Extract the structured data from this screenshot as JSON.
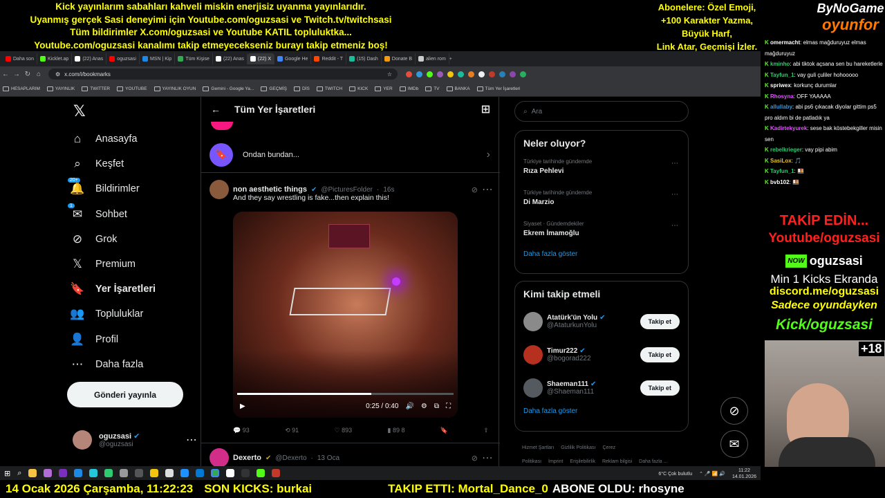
{
  "overlay": {
    "banner_lines": [
      "Kick yayınlarım sabahları kahveli miskin enerjisiz uyanma yayınlarıdır.",
      "Uyanmış gerçek Sasi deneyimi için Youtube.com/oguzsasi ve Twitch.tv/twitchsasi",
      "Tüm bildirimler X.com/oguzsasi ve Youtube KATIL topluluktka...",
      "Youtube.com/oguzsasi kanalımı takip etmeyecekseniz burayı takip etmeniz boş!"
    ],
    "sub_lines": [
      "Abonelere: Özel Emoji,",
      "+100 Karakter Yazma,",
      "Büyük Harf,",
      "Link Atar, Geçmişi İzler."
    ],
    "logo_line1": "ByNoGame",
    "logo_line2": "oyunfor",
    "promo_follow": "TAKİP EDİN...",
    "promo_youtube": "Youtube/oguzsasi",
    "promo_kick_badge": "NOW",
    "promo_kick_name": "oguzsasi",
    "promo_kicks": "Min 1 Kicks Ekranda",
    "promo_discord": "discord.me/oguzsasi",
    "promo_only_game": "Sadece oyundayken",
    "promo_kick_url": "Kick/oguzsasi",
    "age_rating": "+18",
    "ticker_date": "14 Ocak 2026 Çarşamba, 11:22:23",
    "ticker_kicks": "SON KICKS: burkai",
    "ticker_follow": "TAKIP ETTI: Mortal_Dance_0",
    "ticker_sub": "ABONE OLDU: rhosyne"
  },
  "browser": {
    "tabs": [
      {
        "label": "Daha son",
        "color": "#ff0000"
      },
      {
        "label": "Kicklet.ap",
        "color": "#53fc18"
      },
      {
        "label": "(22) Anas",
        "color": "#ffffff"
      },
      {
        "label": "oguzsasi",
        "color": "#ff0000"
      },
      {
        "label": "MSN | Kip",
        "color": "#1e88e5"
      },
      {
        "label": "Tüm Kişise",
        "color": "#34a853"
      },
      {
        "label": "(22) Anas",
        "color": "#ffffff"
      },
      {
        "label": "(22) X",
        "color": "#ffffff"
      },
      {
        "label": "Google He",
        "color": "#4285f4"
      },
      {
        "label": "Reddit - T",
        "color": "#ff4500"
      },
      {
        "label": "(15) Dash",
        "color": "#1abc9c"
      },
      {
        "label": "Donate B",
        "color": "#f39c12"
      },
      {
        "label": "alien rom",
        "color": "#cccccc"
      }
    ],
    "url": "x.com/i/bookmarks",
    "bookmarks": [
      "HESAPLARIM",
      "YAYINLIK",
      "TWITTER",
      "YOUTUBE",
      "YAYINLIK OYUN",
      "Gemini - Google Ya...",
      "GEÇMİŞ",
      "DİS",
      "TWITCH",
      "KICK",
      "YER",
      "IMDb",
      "TV",
      "BANKA",
      "Tüm Yer İşaretleri"
    ]
  },
  "x": {
    "nav": [
      {
        "label": "Anasayfa",
        "icon": "home-icon",
        "glyph": "⌂"
      },
      {
        "label": "Keşfet",
        "icon": "search-icon",
        "glyph": "⌕"
      },
      {
        "label": "Bildirimler",
        "icon": "bell-icon",
        "glyph": "🔔",
        "badge": "20+"
      },
      {
        "label": "Sohbet",
        "icon": "mail-icon",
        "glyph": "✉",
        "badge": "1"
      },
      {
        "label": "Grok",
        "icon": "grok-icon",
        "glyph": "⊘"
      },
      {
        "label": "Premium",
        "icon": "x-premium-icon",
        "glyph": "𝕏"
      },
      {
        "label": "Yer İşaretleri",
        "icon": "bookmark-icon",
        "glyph": "🔖"
      },
      {
        "label": "Topluluklar",
        "icon": "communities-icon",
        "glyph": "👥"
      },
      {
        "label": "Profil",
        "icon": "profile-icon",
        "glyph": "👤"
      },
      {
        "label": "Daha fazla",
        "icon": "more-icon",
        "glyph": "⋯"
      }
    ],
    "post_button": "Gönderi yayınla",
    "me_name": "oguzsasi",
    "me_handle": "@oguzsasi",
    "page_title": "Tüm Yer İşaretleri",
    "folder_name": "Ondan bundan...",
    "tweet": {
      "author": "non aesthetic things",
      "handle": "@PicturesFolder",
      "time": "16s",
      "text": "And they say wrestling is fake...then explain this!",
      "video_time": "0:25 / 0:40",
      "video_progress": 0.62,
      "replies": "93",
      "retweets": "91",
      "likes": "893",
      "views": "89 8"
    },
    "next_tweet": {
      "author": "Dexerto",
      "handle": "@Dexerto",
      "time": "13 Oca"
    },
    "search_placeholder": "Ara",
    "trends_title": "Neler oluyor?",
    "trends": [
      {
        "context": "Türkiye tarihinde gündemde",
        "name": "Rıza Pehlevi"
      },
      {
        "context": "Türkiye tarihinde gündemde",
        "name": "Di Marzio"
      },
      {
        "context": "Siyaset · Gündemdekiler",
        "name": "Ekrem İmamoğlu"
      }
    ],
    "show_more": "Daha fazla göster",
    "who_title": "Kimi takip etmeli",
    "who": [
      {
        "name": "Atatürk'ün Yolu",
        "handle": "@AtaturkunYolu",
        "color": "#8a8a8a"
      },
      {
        "name": "Timur222",
        "handle": "@bogorad222",
        "color": "#b5301f"
      },
      {
        "name": "Shaeman111",
        "handle": "@Shaeman111",
        "color": "#555a60"
      }
    ],
    "follow_label": "Takip et",
    "footer": [
      "Hizmet Şartları",
      "Gizlilik Politikası",
      "Çerez Politikası",
      "İmprint",
      "Erişilebilirlik",
      "Reklam bilgisi",
      "Daha fazla ..."
    ]
  },
  "chat": [
    {
      "user": "omermacht",
      "color": "#ffffff",
      "msg": ": elmas mağduruyuz elmas mağduruyuz"
    },
    {
      "user": "kminho",
      "color": "#2ecc71",
      "msg": ": abi tiktok açsana sen bu hareketlerle"
    },
    {
      "user": "Tayfun_1",
      "color": "#2ecc71",
      "msg": ": vay guli çuliler hohooooo"
    },
    {
      "user": "spriwex",
      "color": "#ffffff",
      "msg": ": korkunç durumlar"
    },
    {
      "user": "Rhosyna",
      "color": "#e056fd",
      "msg": ": OFF YAAAAA"
    },
    {
      "user": "allullaby",
      "color": "#3498db",
      "msg": ": abi ps6 çıkacak diyolar gittim ps5 pro aldım bi de patladık ya"
    },
    {
      "user": "Kadirtekyurek",
      "color": "#e056fd",
      "msg": ": sese bak köstebekgiller misin sen"
    },
    {
      "user": "rebelkrieger",
      "color": "#2ecc71",
      "msg": ": vay pipi abim"
    },
    {
      "user": "SasiLox",
      "color": "#f1c40f",
      "msg": ": 🎵"
    },
    {
      "user": "Tayfun_1",
      "color": "#2ecc71",
      "msg": ": 🍱"
    },
    {
      "user": "bvb102",
      "color": "#ffffff",
      "msg": ": 🍱"
    }
  ],
  "taskbar": {
    "weather": "6°C  Çok bulutlu",
    "time": "11:22",
    "date": "14.01.2026"
  }
}
